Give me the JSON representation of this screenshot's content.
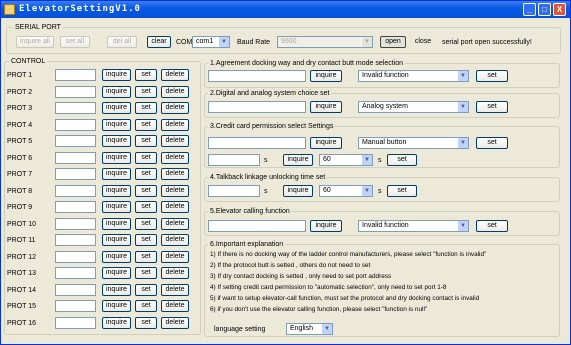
{
  "window": {
    "title": "ElevatorSettingV1.0",
    "minimize": "_",
    "maximize": "□",
    "close": "X"
  },
  "serial": {
    "group_title": "SERIAL PORT",
    "inquire_all": "inquire all",
    "set_all": "set all",
    "del_all": "del all",
    "clear": "clear",
    "com_label": "COM",
    "com_value": "com1",
    "baud_label": "Baud Rate",
    "baud_value": "9600",
    "open": "open",
    "close": "close",
    "status": "serial port open successfully!"
  },
  "control": {
    "group_title": "CONTROL",
    "inquire": "inquire",
    "set": "set",
    "delete": "delete",
    "ports": [
      "PROT 1",
      "PROT 2",
      "PROT 3",
      "PROT 4",
      "PROT 5",
      "PROT 6",
      "PROT 7",
      "PROT 8",
      "PROT 9",
      "PROT 10",
      "PROT 11",
      "PROT 12",
      "PROT 13",
      "PROT 14",
      "PROT 15",
      "PROT 16"
    ]
  },
  "sections": {
    "s1": {
      "title": "1.Agreement docking way and dry contact butt mode selection",
      "inquire": "inquire",
      "select": "Invalid function",
      "set": "set"
    },
    "s2": {
      "title": "2.Digital and analog system choice set",
      "inquire": "inquire",
      "select": "Analog system",
      "set": "set"
    },
    "s3": {
      "title": "3.Credit card permission select Settings",
      "inquire1": "inquire",
      "select1": "Manual button",
      "set1": "set",
      "unit1": "s",
      "inquire2": "inquire",
      "select2": "60",
      "unit2": "s",
      "set2": "set"
    },
    "s4": {
      "title": "4.Talkback linkage unlocking time set",
      "unit1": "s",
      "inquire": "inquire",
      "select": "60",
      "unit2": "s",
      "set": "set"
    },
    "s5": {
      "title": "5.Elevator calling function",
      "inquire": "inquire",
      "select": "Invalid function",
      "set": "set"
    },
    "s6": {
      "title": "6.Important explanation",
      "lines": [
        "1) If there is no docking way of the ladder control manufacturers, please select \"function is invalid\"",
        "2) If the protocol butt is setted , others do not need to set",
        "3) If dry contact docking is setted , only need to set port address",
        "4) If setting credit card permission to \"automatic selection\", only need to set port 1-8",
        "5) if want to setup elevator-call function, must set the protocol and dry docking contact is invalid",
        "6) if you don't use the elevator calling function, please select \"function is null\""
      ],
      "language_label": "language setting",
      "language_value": "English"
    }
  }
}
